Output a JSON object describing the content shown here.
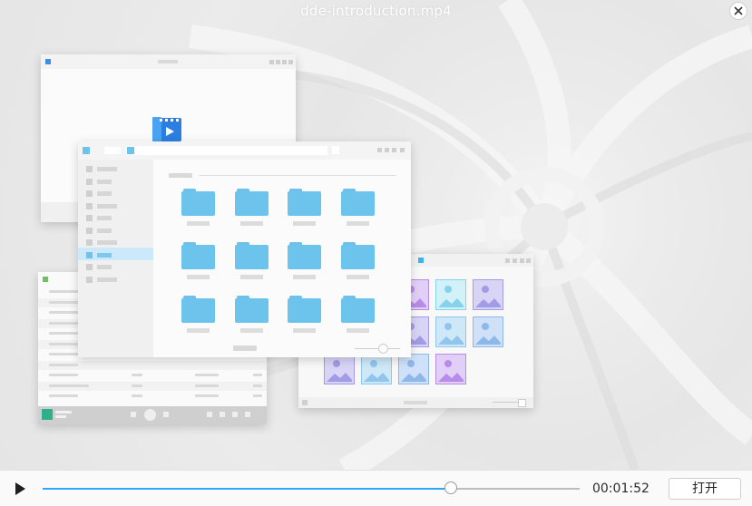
{
  "window": {
    "title": "dde-introduction.mp4"
  },
  "player": {
    "elapsed": "00:01:52",
    "progress": 0.76,
    "open_label": "打开",
    "play_icon": "play-icon",
    "close_icon": "close-icon"
  },
  "colors": {
    "accent": "#2ca7f8",
    "folder": "#6cc4ec",
    "selection": "#cbe9fa"
  },
  "illustration": {
    "folder_rows": 3,
    "folder_cols": 4,
    "image_tile_colors": [
      "#bde0f5",
      "#c9e2f6",
      "#cdb4f0",
      "#b6ecf4",
      "#c9c6f1"
    ]
  }
}
